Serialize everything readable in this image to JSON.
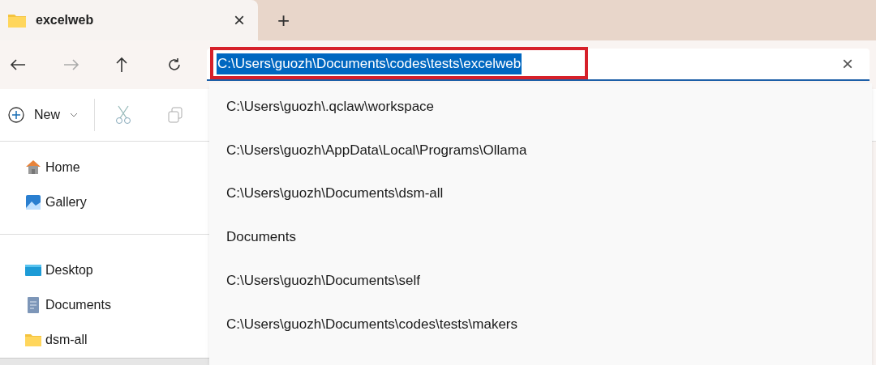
{
  "tab": {
    "title": "excelweb",
    "close": "×",
    "new_tab": "+"
  },
  "address_bar": {
    "value": "C:\\Users\\guozh\\Documents\\codes\\tests\\excelweb",
    "selected": true,
    "clear": "×"
  },
  "command_bar": {
    "new_label": "New"
  },
  "sidebar": {
    "groups": [
      {
        "items": [
          {
            "label": "Home",
            "kind": "home"
          },
          {
            "label": "Gallery",
            "kind": "gallery"
          }
        ]
      },
      {
        "items": [
          {
            "label": "Desktop",
            "kind": "desktop"
          },
          {
            "label": "Documents",
            "kind": "documents"
          },
          {
            "label": "dsm-all",
            "kind": "folder"
          }
        ]
      }
    ]
  },
  "suggestions": [
    "C:\\Users\\guozh\\.qclaw\\workspace",
    "C:\\Users\\guozh\\AppData\\Local\\Programs\\Ollama",
    "C:\\Users\\guozh\\Documents\\dsm-all",
    "Documents",
    "C:\\Users\\guozh\\Documents\\self",
    "C:\\Users\\guozh\\Documents\\codes\\tests\\makers"
  ]
}
